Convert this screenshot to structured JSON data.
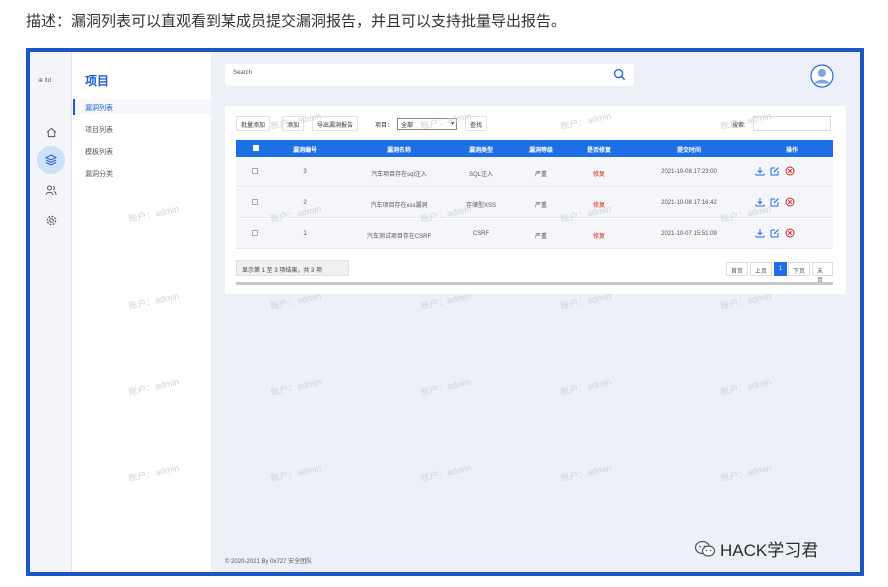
{
  "caption": "描述：漏洞列表可以直观看到某成员提交漏洞报告，并且可以支持批量导出报告。",
  "logo_text": "⊕ ltd",
  "menu": {
    "title": "项目",
    "items": [
      "漏洞列表",
      "项目列表",
      "模板列表",
      "漏洞分类"
    ]
  },
  "search": {
    "placeholder": "Search"
  },
  "toolbar": {
    "batch_add": "批量添加",
    "add": "添加",
    "export": "导出漏洞报告",
    "project_label": "项目：",
    "project_value": "全部",
    "query": "查找",
    "search_label": "搜索:"
  },
  "table": {
    "headers": [
      "漏洞编号",
      "漏洞名称",
      "漏洞类型",
      "漏洞等级",
      "是否修复",
      "提交时间",
      "操作"
    ],
    "rows": [
      {
        "id": "3",
        "name": "汽车项目存在sql注入",
        "type": "SQL注入",
        "level": "严重",
        "fixed": "修复",
        "time": "2021-10-08 17:23:00"
      },
      {
        "id": "2",
        "name": "汽车项目存在xss漏洞",
        "type": "存储型XSS",
        "level": "严重",
        "fixed": "修复",
        "time": "2021-10-08 17:16:42"
      },
      {
        "id": "1",
        "name": "汽车测试项目存在CSRF",
        "type": "CSRF",
        "level": "严重",
        "fixed": "修复",
        "time": "2021-10-07 15:51:09"
      }
    ]
  },
  "pager": {
    "info": "显示第 1 至 3 项结果，共 3 项",
    "first": "首页",
    "prev": "上页",
    "current": "1",
    "next": "下页",
    "last": "末页"
  },
  "copyright": "© 2020-2021 By 0x727 安全团队",
  "watermark": "账户：admin",
  "brand": "HACK学习君",
  "colors": {
    "accent": "#1e6fe6",
    "frame": "#1c56c6",
    "danger": "#e3201b"
  }
}
